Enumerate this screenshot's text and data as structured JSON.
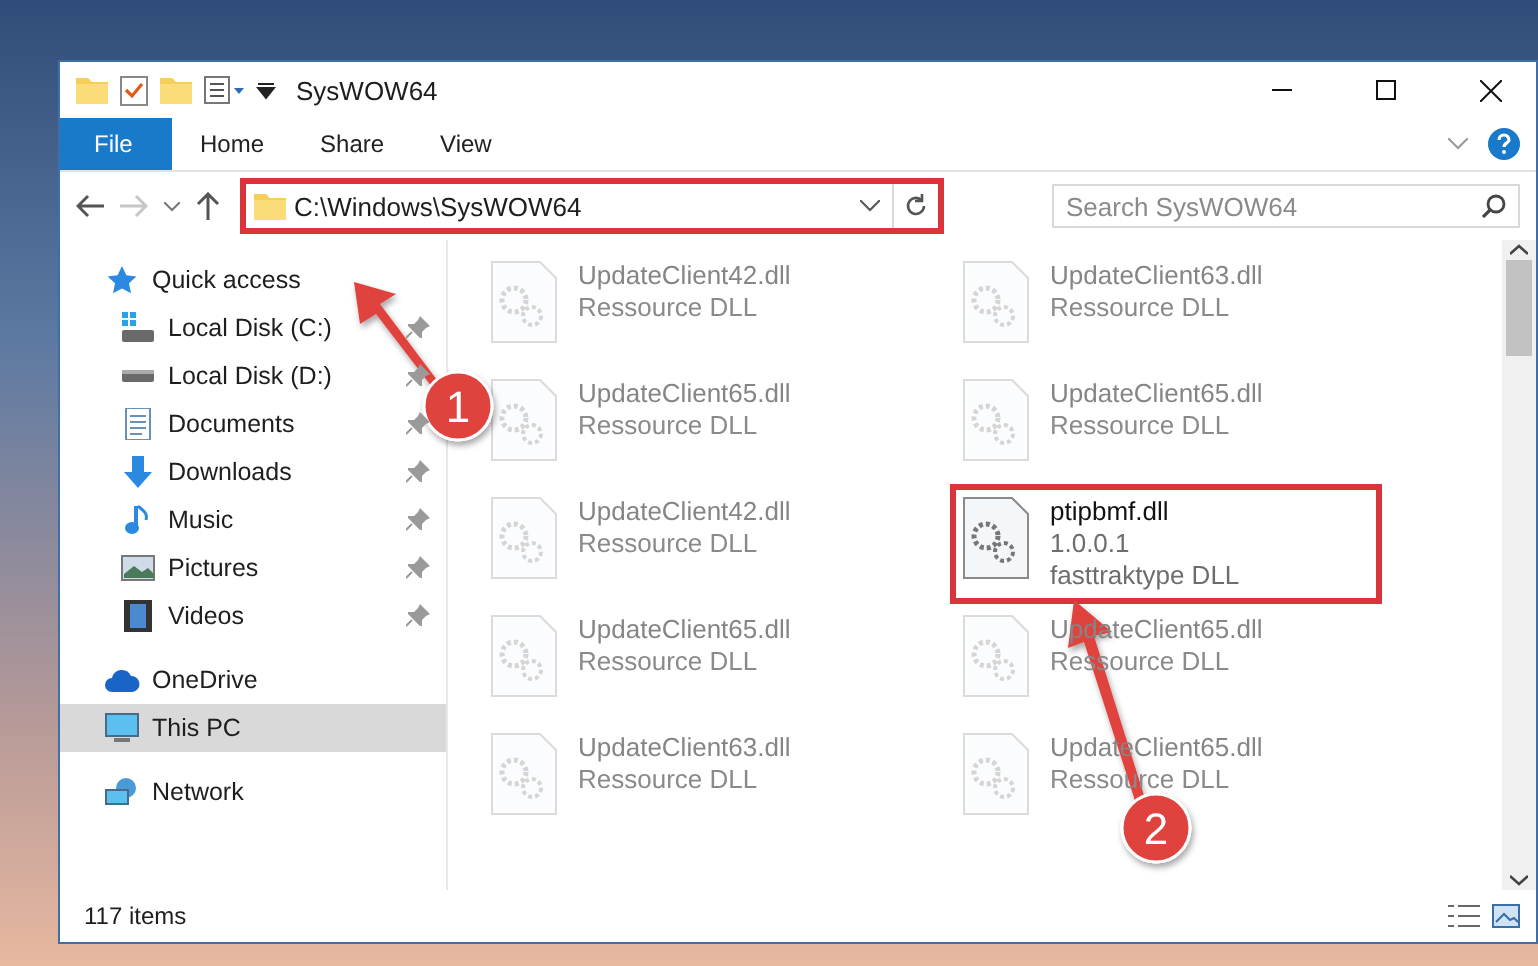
{
  "window": {
    "title": "SysWOW64"
  },
  "ribbon_tabs": [
    {
      "label": "File",
      "selected": true
    },
    {
      "label": "Home",
      "selected": false
    },
    {
      "label": "Share",
      "selected": false
    },
    {
      "label": "View",
      "selected": false
    }
  ],
  "address_bar": {
    "path": "C:\\Windows\\SysWOW64",
    "annotated": true
  },
  "search": {
    "placeholder": "Search SysWOW64"
  },
  "sidebar": {
    "items": [
      {
        "label": "Quick access",
        "kind": "star",
        "selected": false,
        "children": [
          {
            "label": "Local Disk (C:)",
            "kind": "system-drive",
            "pinned": true,
            "selected": false
          },
          {
            "label": "Local Disk (D:)",
            "kind": "drive",
            "pinned": true,
            "selected": false
          },
          {
            "label": "Documents",
            "kind": "documents",
            "pinned": true,
            "selected": false
          },
          {
            "label": "Downloads",
            "kind": "downloads",
            "pinned": true,
            "selected": false
          },
          {
            "label": "Music",
            "kind": "music",
            "pinned": true,
            "selected": false
          },
          {
            "label": "Pictures",
            "kind": "pictures",
            "pinned": true,
            "selected": false
          },
          {
            "label": "Videos",
            "kind": "videos",
            "pinned": true,
            "selected": false
          }
        ]
      },
      {
        "label": "OneDrive",
        "kind": "cloud",
        "selected": false
      },
      {
        "label": "This PC",
        "kind": "pc",
        "selected": true
      },
      {
        "label": "Network",
        "kind": "network",
        "selected": false
      }
    ]
  },
  "files": [
    {
      "name": "UpdateClient42.dll",
      "lines": [
        "Ressource DLL"
      ],
      "annotated": false
    },
    {
      "name": "UpdateClient63.dll",
      "lines": [
        "Ressource DLL"
      ],
      "annotated": false
    },
    {
      "name": "UpdateClient65.dll",
      "lines": [
        "Ressource DLL"
      ],
      "annotated": false
    },
    {
      "name": "UpdateClient65.dll",
      "lines": [
        "Ressource DLL"
      ],
      "annotated": false
    },
    {
      "name": "UpdateClient42.dll",
      "lines": [
        "Ressource DLL"
      ],
      "annotated": false
    },
    {
      "name": "ptipbmf.dll",
      "lines": [
        "1.0.0.1",
        "fasttraktype DLL"
      ],
      "annotated": true
    },
    {
      "name": "UpdateClient65.dll",
      "lines": [
        "Ressource DLL"
      ],
      "annotated": false
    },
    {
      "name": "UpdateClient65.dll",
      "lines": [
        "Ressource DLL"
      ],
      "annotated": false
    },
    {
      "name": "UpdateClient63.dll",
      "lines": [
        "Ressource DLL"
      ],
      "annotated": false
    },
    {
      "name": "UpdateClient65.dll",
      "lines": [
        "Ressource DLL"
      ],
      "annotated": false
    }
  ],
  "status_bar": {
    "item_count": "117 items"
  },
  "annotations": [
    {
      "label": "1"
    },
    {
      "label": "2"
    }
  ]
}
